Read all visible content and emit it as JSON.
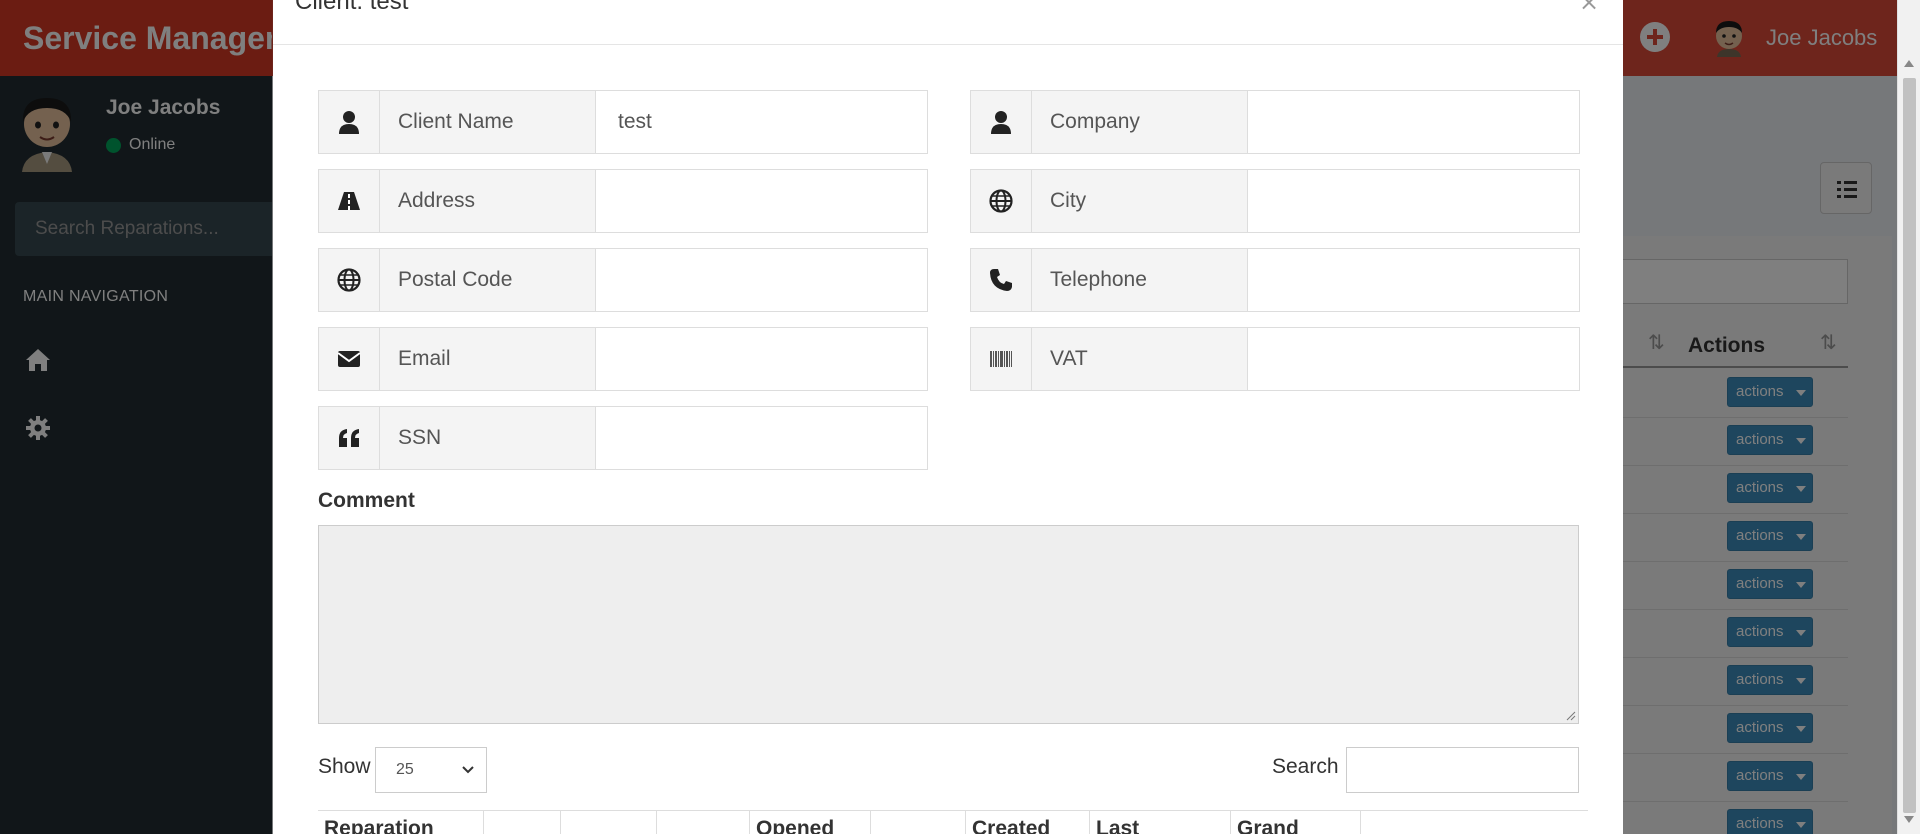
{
  "app": {
    "brand": "Service Managem",
    "top_user_name": "Joe Jacobs"
  },
  "sidebar": {
    "user_name": "Joe Jacobs",
    "status": "Online",
    "search_placeholder": "Search Reparations...",
    "nav_header": "MAIN NAVIGATION",
    "items": [
      {
        "icon": "home-icon"
      },
      {
        "icon": "gear-icon"
      }
    ]
  },
  "background_table": {
    "actions_header": "Actions",
    "row_button": "actions",
    "row_count": 10
  },
  "modal": {
    "title": "Client: test",
    "close": "×",
    "fields": [
      {
        "icon": "user-icon",
        "label": "Client Name",
        "value": "test"
      },
      {
        "icon": "user-icon",
        "label": "Company",
        "value": ""
      },
      {
        "icon": "road-icon",
        "label": "Address",
        "value": ""
      },
      {
        "icon": "globe-icon",
        "label": "City",
        "value": ""
      },
      {
        "icon": "globe-icon",
        "label": "Postal Code",
        "value": ""
      },
      {
        "icon": "phone-icon",
        "label": "Telephone",
        "value": ""
      },
      {
        "icon": "envelope-icon",
        "label": "Email",
        "value": ""
      },
      {
        "icon": "barcode-icon",
        "label": "VAT",
        "value": ""
      },
      {
        "icon": "quote-icon",
        "label": "SSN",
        "value": ""
      }
    ],
    "comment_label": "Comment",
    "comment_value": "",
    "show_label": "Show",
    "show_value": "25",
    "search_label": "Search",
    "search_value": "",
    "table_headers": [
      "Reparation",
      "",
      "",
      "",
      "Opened",
      "",
      "Created",
      "Last",
      "Grand"
    ]
  },
  "colors": {
    "header": "#dd4b39",
    "brand": "#d73925",
    "sidebar": "#222d32",
    "action_button": "#3c8dbc",
    "online": "#00a65a"
  }
}
